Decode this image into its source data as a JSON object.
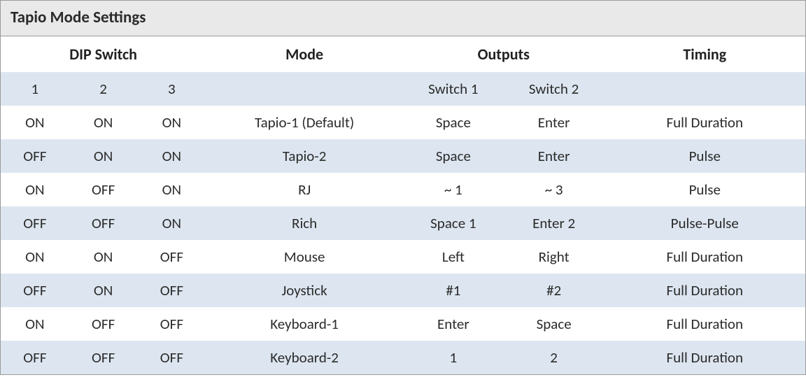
{
  "chart_data": {
    "type": "table",
    "title": "Tapio Mode Settings",
    "columns": [
      "DIP Switch 1",
      "DIP Switch 2",
      "DIP Switch 3",
      "Mode",
      "Outputs Switch 1",
      "Outputs Switch 2",
      "Timing"
    ],
    "rows": [
      [
        "ON",
        "ON",
        "ON",
        "Tapio-1 (Default)",
        "Space",
        "Enter",
        "Full Duration"
      ],
      [
        "OFF",
        "ON",
        "ON",
        "Tapio-2",
        "Space",
        "Enter",
        "Pulse"
      ],
      [
        "ON",
        "OFF",
        "ON",
        "RJ",
        "~ 1",
        "~ 3",
        "Pulse"
      ],
      [
        "OFF",
        "OFF",
        "ON",
        "Rich",
        "Space 1",
        "Enter 2",
        "Pulse-Pulse"
      ],
      [
        "ON",
        "ON",
        "OFF",
        "Mouse",
        "Left",
        "Right",
        "Full Duration"
      ],
      [
        "OFF",
        "ON",
        "OFF",
        "Joystick",
        "#1",
        "#2",
        "Full Duration"
      ],
      [
        "ON",
        "OFF",
        "OFF",
        "Keyboard-1",
        "Enter",
        "Space",
        "Full Duration"
      ],
      [
        "OFF",
        "OFF",
        "OFF",
        "Keyboard-2",
        "1",
        "2",
        "Full Duration"
      ]
    ]
  },
  "title": "Tapio Mode Settings",
  "headers": {
    "dip_switch": "DIP Switch",
    "mode": "Mode",
    "outputs": "Outputs",
    "timing": "Timing"
  },
  "subheaders": {
    "d1": "1",
    "d2": "2",
    "d3": "3",
    "mode": "",
    "out1": "Switch 1",
    "out2": "Switch 2",
    "timing": ""
  },
  "rows": [
    {
      "d1": "ON",
      "d2": "ON",
      "d3": "ON",
      "mode": "Tapio-1 (Default)",
      "out1": "Space",
      "out2": "Enter",
      "timing": "Full Duration"
    },
    {
      "d1": "OFF",
      "d2": "ON",
      "d3": "ON",
      "mode": "Tapio-2",
      "out1": "Space",
      "out2": "Enter",
      "timing": "Pulse"
    },
    {
      "d1": "ON",
      "d2": "OFF",
      "d3": "ON",
      "mode": "RJ",
      "out1": "~ 1",
      "out2": "~ 3",
      "timing": "Pulse"
    },
    {
      "d1": "OFF",
      "d2": "OFF",
      "d3": "ON",
      "mode": "Rich",
      "out1": "Space 1",
      "out2": "Enter 2",
      "timing": "Pulse-Pulse"
    },
    {
      "d1": "ON",
      "d2": "ON",
      "d3": "OFF",
      "mode": "Mouse",
      "out1": "Left",
      "out2": "Right",
      "timing": "Full Duration"
    },
    {
      "d1": "OFF",
      "d2": "ON",
      "d3": "OFF",
      "mode": "Joystick",
      "out1": "#1",
      "out2": "#2",
      "timing": "Full Duration"
    },
    {
      "d1": "ON",
      "d2": "OFF",
      "d3": "OFF",
      "mode": "Keyboard-1",
      "out1": "Enter",
      "out2": "Space",
      "timing": "Full Duration"
    },
    {
      "d1": "OFF",
      "d2": "OFF",
      "d3": "OFF",
      "mode": "Keyboard-2",
      "out1": "1",
      "out2": "2",
      "timing": "Full Duration"
    }
  ]
}
